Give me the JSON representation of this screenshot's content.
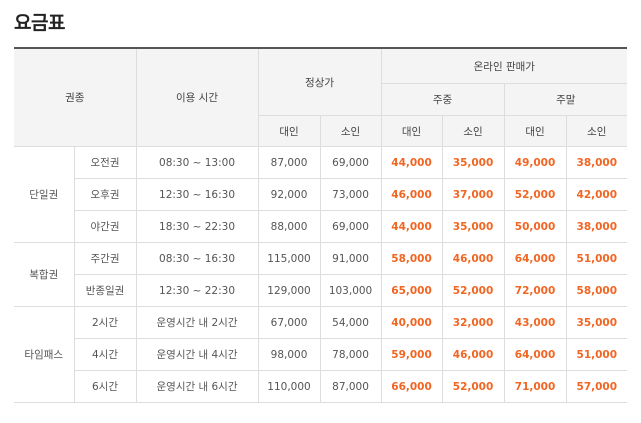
{
  "page": {
    "title": "요금표"
  },
  "header": {
    "ticket_type": "권종",
    "usage_time": "이용 시간",
    "regular": "정상가",
    "online": "온라인 판매가",
    "weekday": "주중",
    "weekend": "주말",
    "adult": "대인",
    "child": "소인"
  },
  "groups": [
    {
      "name": "단일권",
      "rows": [
        {
          "ticket": "오전권",
          "time": "08:30 ~ 13:00",
          "reg_adult": "87,000",
          "reg_child": "69,000",
          "wd_adult": "44,000",
          "wd_child": "35,000",
          "we_adult": "49,000",
          "we_child": "38,000"
        },
        {
          "ticket": "오후권",
          "time": "12:30 ~ 16:30",
          "reg_adult": "92,000",
          "reg_child": "73,000",
          "wd_adult": "46,000",
          "wd_child": "37,000",
          "we_adult": "52,000",
          "we_child": "42,000"
        },
        {
          "ticket": "야간권",
          "time": "18:30 ~ 22:30",
          "reg_adult": "88,000",
          "reg_child": "69,000",
          "wd_adult": "44,000",
          "wd_child": "35,000",
          "we_adult": "50,000",
          "we_child": "38,000"
        }
      ]
    },
    {
      "name": "복합권",
      "rows": [
        {
          "ticket": "주간권",
          "time": "08:30 ~ 16:30",
          "reg_adult": "115,000",
          "reg_child": "91,000",
          "wd_adult": "58,000",
          "wd_child": "46,000",
          "we_adult": "64,000",
          "we_child": "51,000"
        },
        {
          "ticket": "반종일권",
          "time": "12:30 ~ 22:30",
          "reg_adult": "129,000",
          "reg_child": "103,000",
          "wd_adult": "65,000",
          "wd_child": "52,000",
          "we_adult": "72,000",
          "we_child": "58,000"
        }
      ]
    },
    {
      "name": "타임패스",
      "rows": [
        {
          "ticket": "2시간",
          "time": "운영시간 내 2시간",
          "reg_adult": "67,000",
          "reg_child": "54,000",
          "wd_adult": "40,000",
          "wd_child": "32,000",
          "we_adult": "43,000",
          "we_child": "35,000"
        },
        {
          "ticket": "4시간",
          "time": "운영시간 내 4시간",
          "reg_adult": "98,000",
          "reg_child": "78,000",
          "wd_adult": "59,000",
          "wd_child": "46,000",
          "we_adult": "64,000",
          "we_child": "51,000"
        },
        {
          "ticket": "6시간",
          "time": "운영시간 내 6시간",
          "reg_adult": "110,000",
          "reg_child": "87,000",
          "wd_adult": "66,000",
          "wd_child": "52,000",
          "we_adult": "71,000",
          "we_child": "57,000"
        }
      ]
    }
  ],
  "colors": {
    "sale_price": "#f26522",
    "header_bg": "#f4f4f4",
    "border": "#dddddd"
  }
}
